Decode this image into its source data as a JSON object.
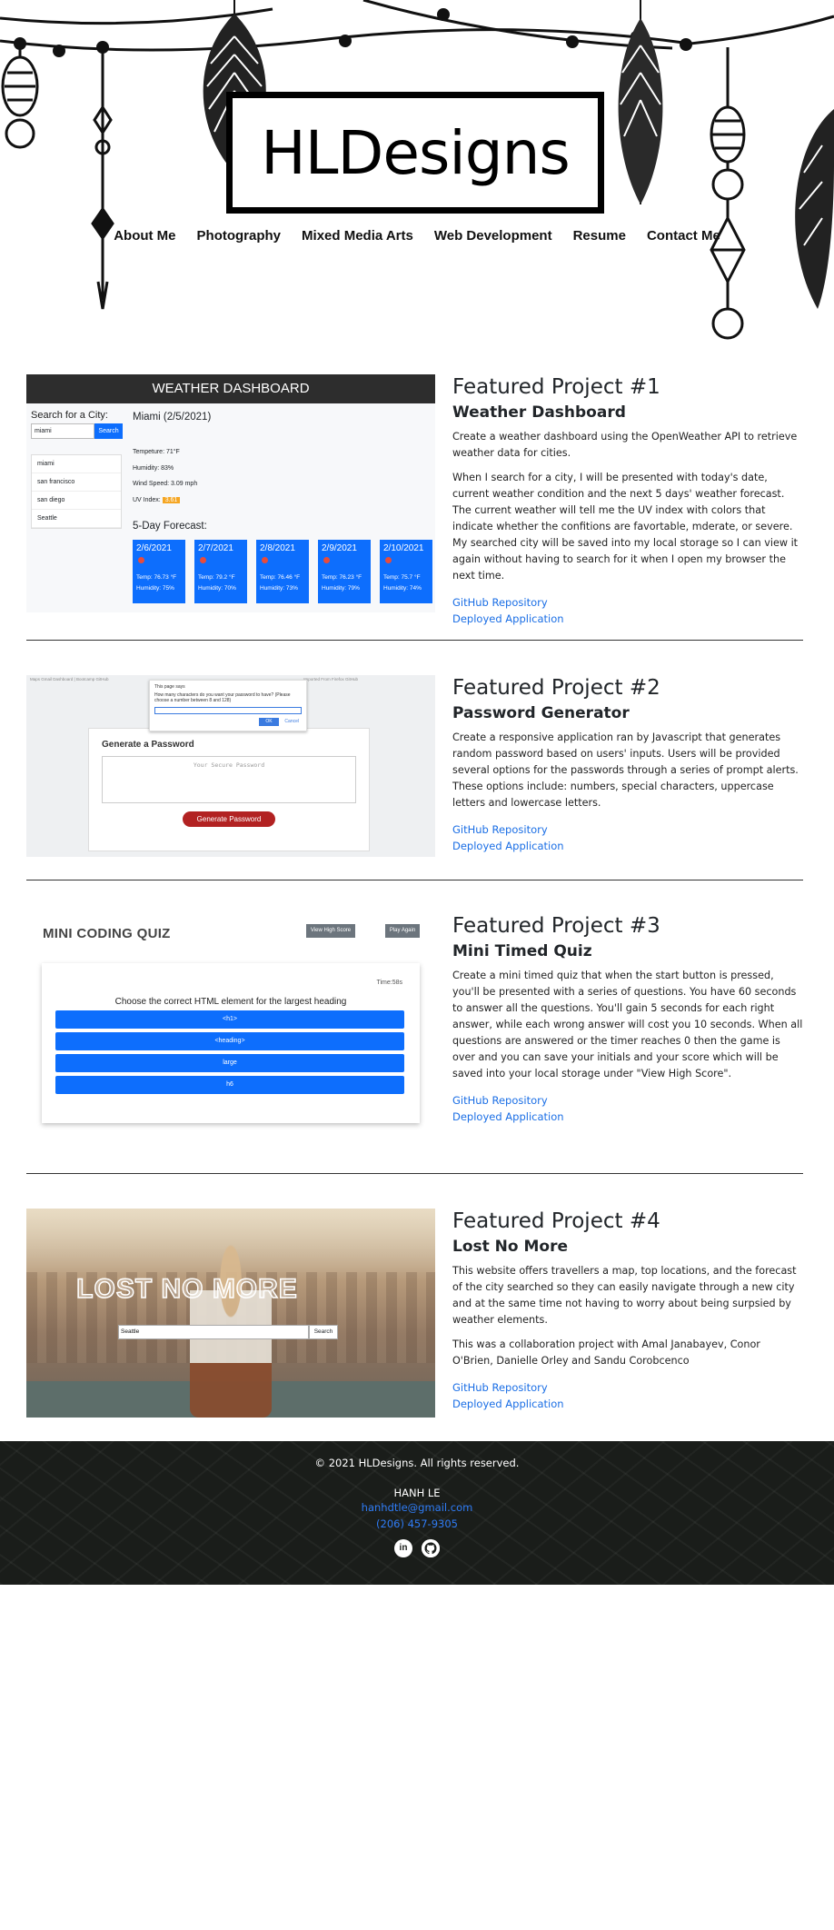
{
  "header": {
    "logo": "HLDesigns",
    "nav": [
      "About Me",
      "Photography",
      "Mixed Media Arts",
      "Web Development",
      "Resume",
      "Contact Me"
    ]
  },
  "projects": [
    {
      "title": "Featured Project #1",
      "subtitle": "Weather Dashboard",
      "paragraphs": [
        "Create a weather dashboard using the OpenWeather API to retrieve weather data for cities.",
        "When I search for a city, I will be presented with today's date, current weather condition and the next 5 days' weather forecast. The current weather will tell me the UV index with colors that indicate whether the confitions are favortable, mderate, or severe. My searched city will be saved into my local storage so I can view it again without having to search for it when I open my browser the next time."
      ],
      "links": [
        "GitHub Repository",
        "Deployed Application"
      ],
      "screenshot": {
        "banner": "WEATHER DASHBOARD",
        "search_label": "Search for a City:",
        "search_value": "miami",
        "search_button": "Search",
        "history": [
          "miami",
          "san francisco",
          "san diego",
          "Seattle"
        ],
        "city": "Miami (2/5/2021)",
        "temp": "Tempeture: 71°F",
        "humidity": "Humidity: 83%",
        "wind": "Wind Speed: 3.09 mph",
        "uv_label": "UV Index:",
        "uv_value": "3.61",
        "forecast_label": "5-Day Forecast:",
        "forecast": [
          {
            "date": "2/6/2021",
            "temp": "Temp: 76.73 °F",
            "humidity": "Humidity: 75%"
          },
          {
            "date": "2/7/2021",
            "temp": "Temp: 79.2 °F",
            "humidity": "Humidity: 70%"
          },
          {
            "date": "2/8/2021",
            "temp": "Temp: 76.46 °F",
            "humidity": "Humidity: 73%"
          },
          {
            "date": "2/9/2021",
            "temp": "Temp: 76.23 °F",
            "humidity": "Humidity: 79%"
          },
          {
            "date": "2/10/2021",
            "temp": "Temp: 75.7 °F",
            "humidity": "Humidity: 74%"
          }
        ]
      }
    },
    {
      "title": "Featured Project #2",
      "subtitle": "Password Generator",
      "paragraphs": [
        "Create a responsive application ran by Javascript that generates random password based on users' inputs. Users will be provided several options for the passwords through a series of prompt alerts. These options include: numbers, special characters, uppercase letters and lowercase letters."
      ],
      "links": [
        "GitHub Repository",
        "Deployed Application"
      ],
      "screenshot": {
        "bookmarks": "Maps   Gmail   Dashboard | Bootcamp   GitHub",
        "bookmarks_right": "Imported From Firefox   GitHub",
        "dialog_title": "This page says",
        "dialog_text": "How many characters do you want your password to have? (Please choose a number between 8 and 128)",
        "dialog_ok": "OK",
        "dialog_cancel": "Cancel",
        "card_title": "Generate a Password",
        "placeholder": "Your Secure Password",
        "button": "Generate Password"
      }
    },
    {
      "title": "Featured Project #3",
      "subtitle": "Mini Timed Quiz",
      "paragraphs": [
        "Create a mini timed quiz that when the start button is pressed, you'll be presented with a series of questions. You have 60 seconds to answer all the questions. You'll gain 5 seconds for each right answer, while each wrong answer will cost you 10 seconds. When all questions are answered or the timer reaches 0 then the game is over and you can save your initials and your score which will be saved into your local storage under \"View High Score\"."
      ],
      "links": [
        "GitHub Repository",
        "Deployed Application"
      ],
      "screenshot": {
        "title": "MINI CODING QUIZ",
        "high_score": "View High Score",
        "play_again": "Play Again",
        "time": "Time:58s",
        "question": "Choose the correct HTML element for the largest heading",
        "answers": [
          "<h1>",
          "<heading>",
          "large",
          "h6"
        ]
      }
    },
    {
      "title": "Featured Project #4",
      "subtitle": "Lost No More",
      "paragraphs": [
        "This website offers travellers a map, top locations, and the forecast of the city searched so they can easily navigate through a new city and at the same time not having to worry about being surpsied by weather elements.",
        "This was a collaboration project with Amal Janabayev, Conor O'Brien, Danielle Orley and Sandu Corobcenco"
      ],
      "links": [
        "GitHub Repository",
        "Deployed Application"
      ],
      "screenshot": {
        "logo": "LOST NO MORE",
        "search_value": "Seattle",
        "search_button": "Search"
      }
    }
  ],
  "footer": {
    "copyright": "© 2021 HLDesigns. All rights reserved.",
    "name": "HANH LE",
    "email": "hanhdtle@gmail.com",
    "phone": "(206) 457-9305",
    "icons": [
      "linkedin-icon",
      "github-icon"
    ]
  }
}
